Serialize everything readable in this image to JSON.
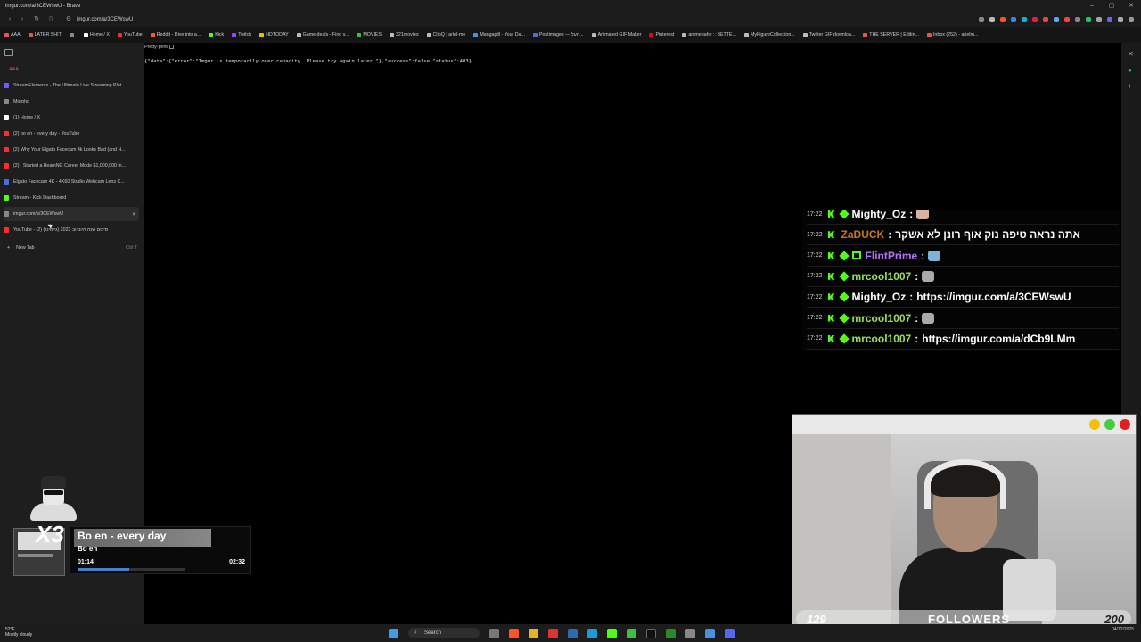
{
  "window": {
    "title": "imgur.com/a/3CEWswU - Brave",
    "controls": [
      "–",
      "▢",
      "✕"
    ]
  },
  "address_bar": {
    "url": "imgur.com/a/3CEWswU"
  },
  "bookmarks": [
    {
      "label": "AAA",
      "color": "#e05555"
    },
    {
      "label": "LATER SHIT",
      "color": "#e05555"
    },
    {
      "label": "",
      "color": "#888888"
    },
    {
      "label": "Home / X",
      "color": "#ffffff"
    },
    {
      "label": "YouTube",
      "color": "#ff2a2a"
    },
    {
      "label": "Reddit - Dive into a...",
      "color": "#ff5a1f"
    },
    {
      "label": "Kick",
      "color": "#53fc18"
    },
    {
      "label": "Twitch",
      "color": "#9146ff"
    },
    {
      "label": "HDTODAY",
      "color": "#e6c200"
    },
    {
      "label": "Game deals - Find v...",
      "color": "#bbbbbb"
    },
    {
      "label": "MOVIES",
      "color": "#3fbf3f"
    },
    {
      "label": "321movies",
      "color": "#bbbbbb"
    },
    {
      "label": "ClipQ | ariel-me",
      "color": "#bbbbbb"
    },
    {
      "label": "Mangapill - Your Da...",
      "color": "#4a90e2"
    },
    {
      "label": "Postimages — העל...",
      "color": "#4a6ee2"
    },
    {
      "label": "Animated GIF Maker",
      "color": "#bbbbbb"
    },
    {
      "label": "Pinterest",
      "color": "#e60023"
    },
    {
      "label": "animepahe :: BETTE...",
      "color": "#bbbbbb"
    },
    {
      "label": "MyFigureCollection...",
      "color": "#bbbbbb"
    },
    {
      "label": "Twitter GIF downloa...",
      "color": "#bbbbbb"
    },
    {
      "label": "THE SERVER | Editin...",
      "color": "#e05555"
    },
    {
      "label": "Inbox (252) - arielm...",
      "color": "#e05555"
    }
  ],
  "sidebar": {
    "group_label": "AAA",
    "tabs": [
      {
        "label": "StreamElements - The Ultimate Live Streaming Plat...",
        "color": "#6b5cff"
      },
      {
        "label": "Morpho",
        "color": "#888888"
      },
      {
        "label": "(1) Home / X",
        "color": "#ffffff"
      },
      {
        "label": "(2) bo en - every day - YouTube",
        "color": "#ff2a2a"
      },
      {
        "label": "(2) Why Your Elgato Facecam 4k Looks Bad (and H...",
        "color": "#ff2a2a"
      },
      {
        "label": "(2) I Started a BeamNG Career Mode $1,000,000 in...",
        "color": "#ff2a2a"
      },
      {
        "label": "Elgato Facecam 4K - 4K60 Studio Webcam Lens C...",
        "color": "#4a6ee2"
      },
      {
        "label": "Stream - Kick Dashboard",
        "color": "#53fc18"
      },
      {
        "label": "imgur.com/a/3CEWswU",
        "color": "#888888",
        "active": true
      },
      {
        "label": "YouTube - (2) סיכום שנה היוטיוב 2023 (גיימינג)",
        "color": "#ff2a2a"
      }
    ],
    "new_tab": {
      "label": "New Tab",
      "shortcut": "Ctrl T"
    }
  },
  "page": {
    "pretty_print_label": "Pretty-print",
    "json_text": "{\"data\":{\"error\":\"Imgur is temporarily over capacity. Please try again later.\"},\"success\":false,\"status\":403}"
  },
  "chat": {
    "messages": [
      {
        "time": "17:22",
        "user": "Mighty_Oz",
        "user_color": "#ffffff",
        "badge": "diamond",
        "text": "",
        "emote": "#d8b4a0"
      },
      {
        "time": "17:22",
        "user": "ZaDUCK",
        "user_color": "#c8761e",
        "badge": "none",
        "text": "אתה נראה טיפה נוק אוף רונן לא אשקר",
        "emote": ""
      },
      {
        "time": "17:22",
        "user": "FlintPrime",
        "user_color": "#b873f5",
        "badge": "diamond-box",
        "text": "",
        "emote": "#7fb3d5"
      },
      {
        "time": "17:22",
        "user": "mrcool1007",
        "user_color": "#9be05a",
        "badge": "diamond",
        "text": "",
        "emote": "#aaaaaa"
      },
      {
        "time": "17:22",
        "user": "Mighty_Oz",
        "user_color": "#ffffff",
        "badge": "diamond",
        "text": "https://imgur.com/a/3CEWswU",
        "emote": ""
      },
      {
        "time": "17:22",
        "user": "mrcool1007",
        "user_color": "#9be05a",
        "badge": "diamond",
        "text": "",
        "emote": "#aaaaaa"
      },
      {
        "time": "17:22",
        "user": "mrcool1007",
        "user_color": "#9be05a",
        "badge": "diamond",
        "text": "https://imgur.com/a/dCb9LMm",
        "emote": ""
      }
    ]
  },
  "webcam": {
    "lights": [
      "#f2c200",
      "#3fcf3f",
      "#e02020"
    ],
    "followers": {
      "current": "129",
      "label": "FOLLOWERS",
      "goal": "200",
      "progress": 0.645
    }
  },
  "now_playing": {
    "multiplier": "X3",
    "title": "Bo en - every day",
    "artist": "Bo en",
    "elapsed": "01:14",
    "total": "02:32",
    "progress": 0.487
  },
  "taskbar": {
    "weather_temp": "52°F",
    "weather_desc": "Mostly cloudy",
    "search_label": "Search",
    "date": "04/12/2025"
  }
}
